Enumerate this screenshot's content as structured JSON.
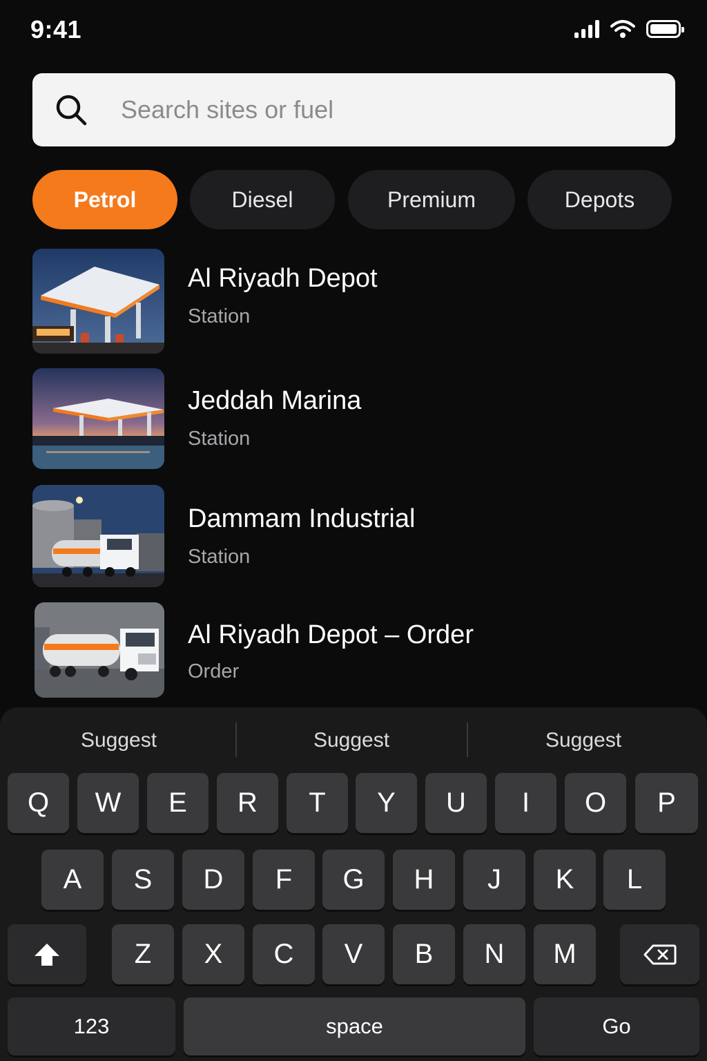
{
  "status_bar": {
    "time": "9:41"
  },
  "search": {
    "placeholder": "Search sites or fuel",
    "value": ""
  },
  "filters": [
    {
      "label": "Petrol",
      "selected": true
    },
    {
      "label": "Diesel",
      "selected": false
    },
    {
      "label": "Premium",
      "selected": false
    },
    {
      "label": "Depots",
      "selected": false
    }
  ],
  "results": [
    {
      "title": "Al Riyadh Depot",
      "type": "Station",
      "image": "gas-station-night"
    },
    {
      "title": "Jeddah Marina",
      "type": "Station",
      "image": "gas-station-waterfront"
    },
    {
      "title": "Dammam Industrial",
      "type": "Station",
      "image": "industrial-tanker"
    },
    {
      "title": "Al Riyadh Depot – Order",
      "type": "Order",
      "image": "fuel-tanker-truck"
    }
  ],
  "keyboard": {
    "suggestions": [
      "Suggest",
      "Suggest",
      "Suggest"
    ],
    "row1": [
      "Q",
      "W",
      "E",
      "R",
      "T",
      "Y",
      "U",
      "I",
      "O",
      "P"
    ],
    "row2": [
      "A",
      "S",
      "D",
      "F",
      "G",
      "H",
      "J",
      "K",
      "L"
    ],
    "row3": [
      "Z",
      "X",
      "C",
      "V",
      "B",
      "N",
      "M"
    ],
    "numbers_label": "123",
    "space_label": "space",
    "go_label": "Go"
  },
  "colors": {
    "accent": "#f47a1c",
    "background": "#0b0b0c",
    "chip": "#1e1e20",
    "key": "#3a3a3c"
  }
}
